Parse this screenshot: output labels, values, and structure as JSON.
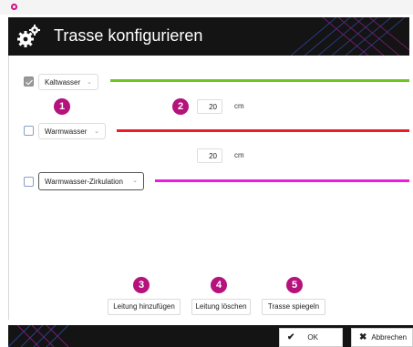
{
  "header": {
    "title": "Trasse konfigurieren"
  },
  "rows": [
    {
      "pipe": "Kaltwasser",
      "checked": true,
      "color": "#6cc61c"
    },
    {
      "pipe": "Warmwasser",
      "checked": false,
      "color": "#ee1c24"
    },
    {
      "pipe": "Warmwasser-Zirkulation",
      "checked": false,
      "color": "#ee1ae0"
    }
  ],
  "spacings": [
    {
      "value": "20",
      "unit": "cm"
    },
    {
      "value": "20",
      "unit": "cm"
    }
  ],
  "badges": [
    "1",
    "2",
    "3",
    "4",
    "5"
  ],
  "actions": {
    "add": "Leitung hinzufügen",
    "delete": "Leitung löschen",
    "mirror": "Trasse spiegeln"
  },
  "footer": {
    "ok": "OK",
    "cancel": "Abbrechen"
  },
  "colors": {
    "accent": "#b5127c",
    "header_bg": "#141414"
  }
}
